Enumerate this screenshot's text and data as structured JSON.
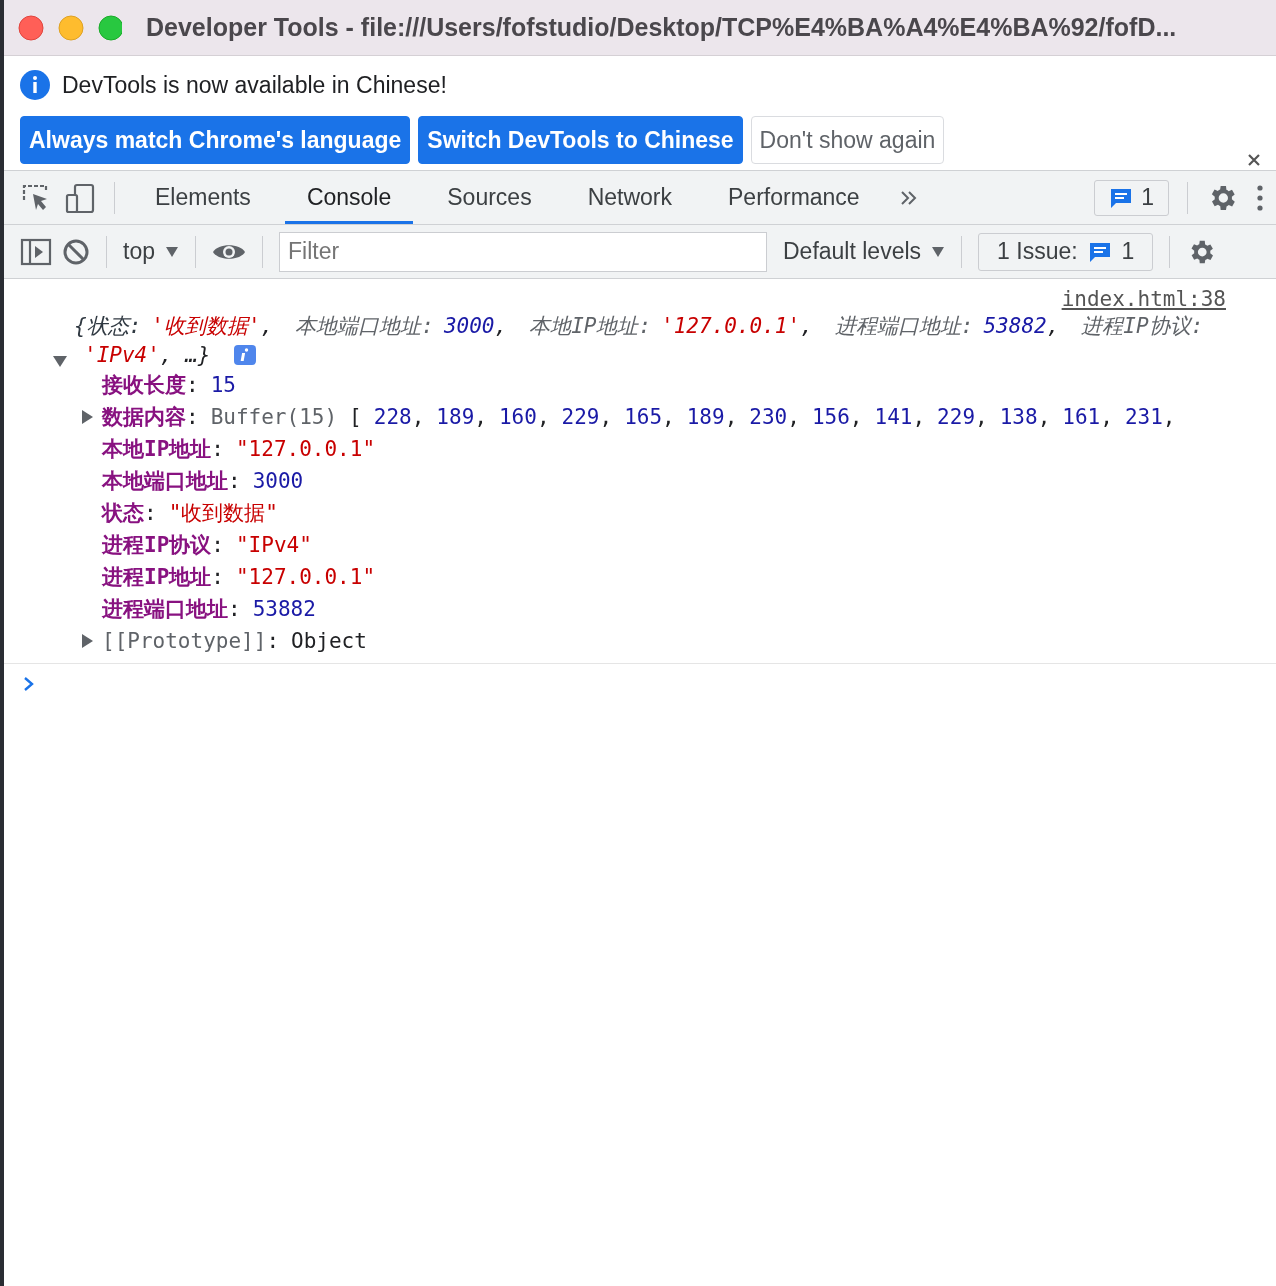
{
  "window": {
    "title": "Developer Tools - file:///Users/fofstudio/Desktop/TCP%E4%BA%A4%E4%BA%92/fofD..."
  },
  "infobar": {
    "message": "DevTools is now available in Chinese!",
    "buttons": [
      {
        "label": "Always match Chrome's language",
        "kind": "primary"
      },
      {
        "label": "Switch DevTools to Chinese",
        "kind": "primary"
      },
      {
        "label": "Don't show again",
        "kind": "secondary"
      }
    ]
  },
  "tabs": [
    {
      "label": "Elements",
      "selected": false
    },
    {
      "label": "Console",
      "selected": true
    },
    {
      "label": "Sources",
      "selected": false
    },
    {
      "label": "Network",
      "selected": false
    },
    {
      "label": "Performance",
      "selected": false
    }
  ],
  "messages_badge": "1",
  "console_toolbar": {
    "context": "top",
    "filter": {
      "placeholder": "Filter"
    },
    "levels": "Default levels",
    "issues_label": "1 Issue:",
    "issues_count": "1"
  },
  "entry": {
    "source": "index.html:38",
    "expanded": true,
    "summary": [
      {
        "text": "{状态:",
        "kind": "key"
      },
      {
        "text": "'收到数据'",
        "kind": "string"
      },
      {
        "text": ",",
        "kind": "punct"
      },
      {
        "text": "本地端口地址:",
        "kind": "key"
      },
      {
        "text": "3000",
        "kind": "number"
      },
      {
        "text": ",",
        "kind": "punct"
      },
      {
        "text": "本地IP地址:",
        "kind": "key"
      },
      {
        "text": "'127.0.0.1'",
        "kind": "string"
      },
      {
        "text": ",",
        "kind": "punct"
      },
      {
        "text": "进程端口地址:",
        "kind": "key"
      },
      {
        "text": "53882",
        "kind": "number"
      },
      {
        "text": ",",
        "kind": "punct"
      },
      {
        "text": "进程IP协议:",
        "kind": "key"
      },
      {
        "text": "'IPv4'",
        "kind": "string"
      },
      {
        "text": ", …}",
        "kind": "punct"
      }
    ],
    "key_separator": ":",
    "properties": [
      {
        "key": "接收长度",
        "kind": "number",
        "value": "15"
      },
      {
        "key": "数据内容",
        "kind": "buffer",
        "expanded": false,
        "value": "Buffer(15)",
        "tokens": [
          {
            "text": "[",
            "kind": "punct"
          },
          {
            "text": "228",
            "kind": "number"
          },
          {
            "text": ",",
            "kind": "punct"
          },
          {
            "text": "189",
            "kind": "number"
          },
          {
            "text": ",",
            "kind": "punct"
          },
          {
            "text": "160",
            "kind": "number"
          },
          {
            "text": ",",
            "kind": "punct"
          },
          {
            "text": "229",
            "kind": "number"
          },
          {
            "text": ",",
            "kind": "punct"
          },
          {
            "text": "165",
            "kind": "number"
          },
          {
            "text": ",",
            "kind": "punct"
          },
          {
            "text": "189",
            "kind": "number"
          },
          {
            "text": ",",
            "kind": "punct"
          },
          {
            "text": "230",
            "kind": "number"
          },
          {
            "text": ",",
            "kind": "punct"
          },
          {
            "text": "156",
            "kind": "number"
          },
          {
            "text": ",",
            "kind": "punct"
          },
          {
            "text": "141",
            "kind": "number"
          },
          {
            "text": ",",
            "kind": "punct"
          },
          {
            "text": "229",
            "kind": "number"
          },
          {
            "text": ",",
            "kind": "punct"
          },
          {
            "text": "138",
            "kind": "number"
          },
          {
            "text": ",",
            "kind": "punct"
          },
          {
            "text": "161",
            "kind": "number"
          },
          {
            "text": ",",
            "kind": "punct"
          },
          {
            "text": "231",
            "kind": "number"
          },
          {
            "text": ",",
            "kind": "punct"
          }
        ]
      },
      {
        "key": "本地IP地址",
        "kind": "string",
        "value": "\"127.0.0.1\""
      },
      {
        "key": "本地端口地址",
        "kind": "number",
        "value": "3000"
      },
      {
        "key": "状态",
        "kind": "string",
        "value": "\"收到数据\""
      },
      {
        "key": "进程IP协议",
        "kind": "string",
        "value": "\"IPv4\""
      },
      {
        "key": "进程IP地址",
        "kind": "string",
        "value": "\"127.0.0.1\""
      },
      {
        "key": "进程端口地址",
        "kind": "number",
        "value": "53882"
      },
      {
        "key": "[[Prototype]]",
        "kind": "proto",
        "expanded": false,
        "value": "Object"
      }
    ]
  }
}
